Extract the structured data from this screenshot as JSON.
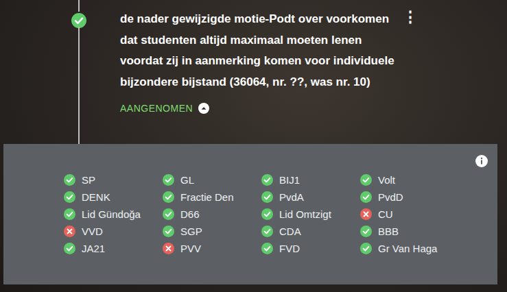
{
  "motion": {
    "title": "de nader gewijzigde motie-Podt over voorkomen dat studenten altijd maximaal moeten lenen voordat zij in aanmerking komen voor individuele bijzondere bijstand (36064, nr. ??, was nr. 10)",
    "adopted": true,
    "status": "AANGENOMEN",
    "expanded": true,
    "menu_icon": "⋮"
  },
  "votes": [
    {
      "party": "SP",
      "for": true
    },
    {
      "party": "GL",
      "for": true
    },
    {
      "party": "BIJ1",
      "for": true
    },
    {
      "party": "Volt",
      "for": true
    },
    {
      "party": "DENK",
      "for": true
    },
    {
      "party": "Fractie Den",
      "for": true
    },
    {
      "party": "PvdA",
      "for": true
    },
    {
      "party": "PvdD",
      "for": true
    },
    {
      "party": "Lid Gündoğa",
      "for": true
    },
    {
      "party": "D66",
      "for": true
    },
    {
      "party": "Lid Omtzigt",
      "for": true
    },
    {
      "party": "CU",
      "for": false
    },
    {
      "party": "VVD",
      "for": false
    },
    {
      "party": "SGP",
      "for": true
    },
    {
      "party": "CDA",
      "for": true
    },
    {
      "party": "BBB",
      "for": true
    },
    {
      "party": "JA21",
      "for": true
    },
    {
      "party": "PVV",
      "for": false
    },
    {
      "party": "FVD",
      "for": true
    },
    {
      "party": "Gr Van Haga",
      "for": true
    }
  ]
}
